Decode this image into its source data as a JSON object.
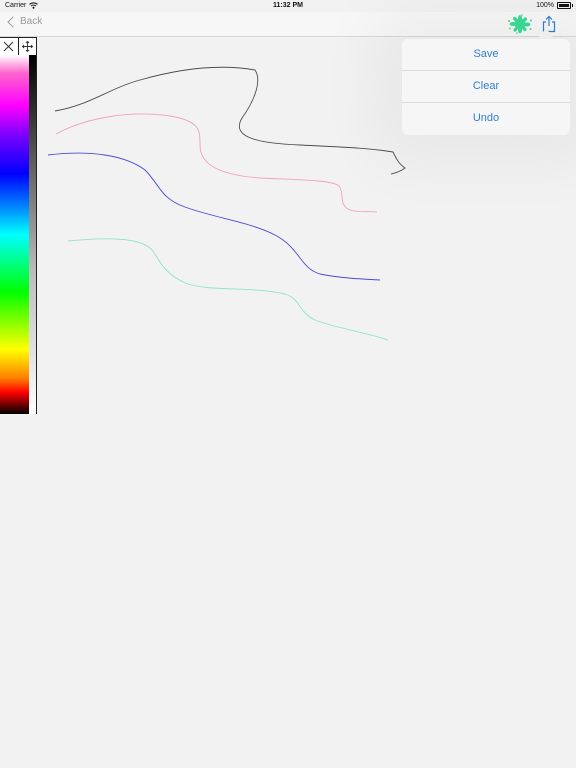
{
  "status_bar": {
    "carrier": "Carrier",
    "time": "11:32 PM",
    "battery": "100%"
  },
  "nav": {
    "back_label": "Back",
    "brush_icon": "paint-splat-icon",
    "share_icon": "share-icon"
  },
  "menu": {
    "items": [
      {
        "label": "Save"
      },
      {
        "label": "Clear"
      },
      {
        "label": "Undo"
      }
    ]
  },
  "palette": {
    "close_icon": "close-icon",
    "move_icon": "move-icon"
  },
  "colors": {
    "accent": "#2f7fd2",
    "brush": "#3ddc97",
    "stroke_black": "#4d4d4d",
    "stroke_pink": "#f2a3b5",
    "stroke_blue": "#4a4ad6",
    "stroke_mint": "#8ee6c4"
  }
}
